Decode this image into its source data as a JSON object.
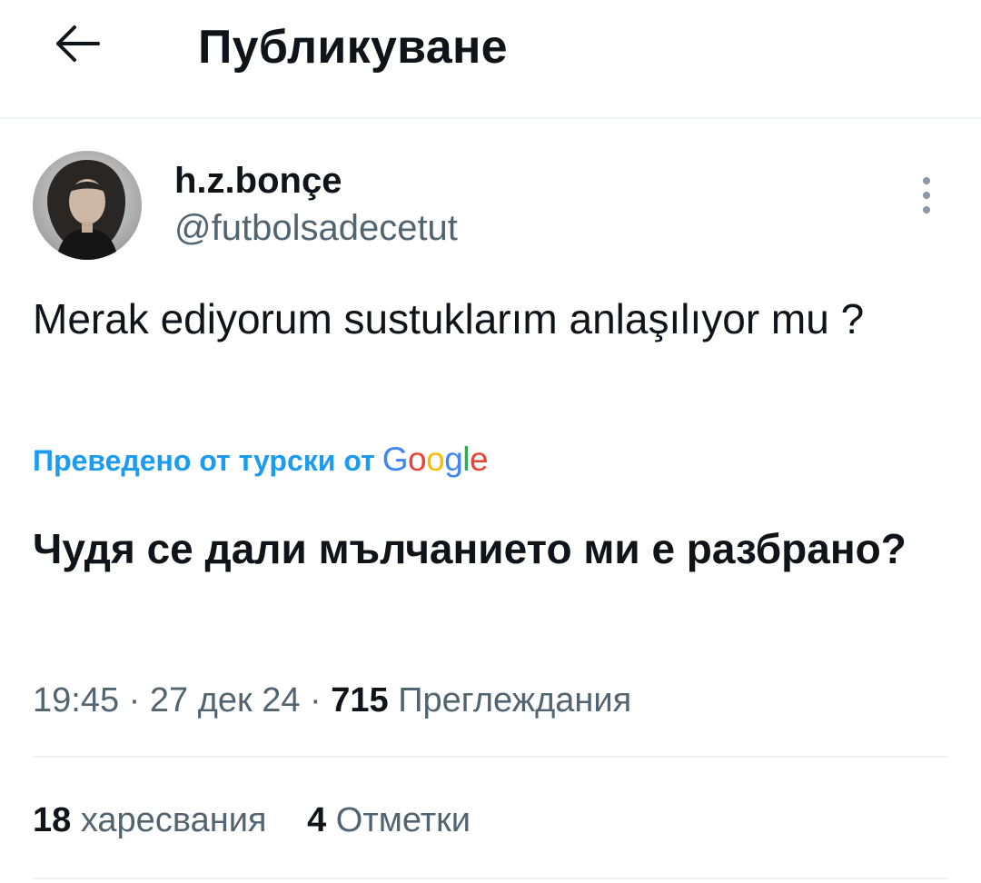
{
  "header": {
    "title": "Публикуване",
    "back_icon": "arrow-left-icon"
  },
  "author": {
    "display_name": "h.z.bonçe",
    "handle": "@futbolsadecetut",
    "more_icon": "vertical-dots-icon"
  },
  "tweet": {
    "text": "Merak ediyorum sustuklarım anlaşılıyor mu ?",
    "translated_label": "Преведено от турски от",
    "translation_provider": "Google",
    "translation": "Чудя се дали мълчанието ми е разбрано?"
  },
  "meta": {
    "time": "19:45",
    "date": "27 дек 24",
    "separator": "·",
    "views_count": "715",
    "views_label": "Преглеждания"
  },
  "stats": {
    "likes_count": "18",
    "likes_label": "харесвания",
    "bookmarks_count": "4",
    "bookmarks_label": "Отметки"
  },
  "colors": {
    "link_blue": "#1d9bf0",
    "secondary_text": "#536471",
    "primary_text": "#0f1419"
  }
}
